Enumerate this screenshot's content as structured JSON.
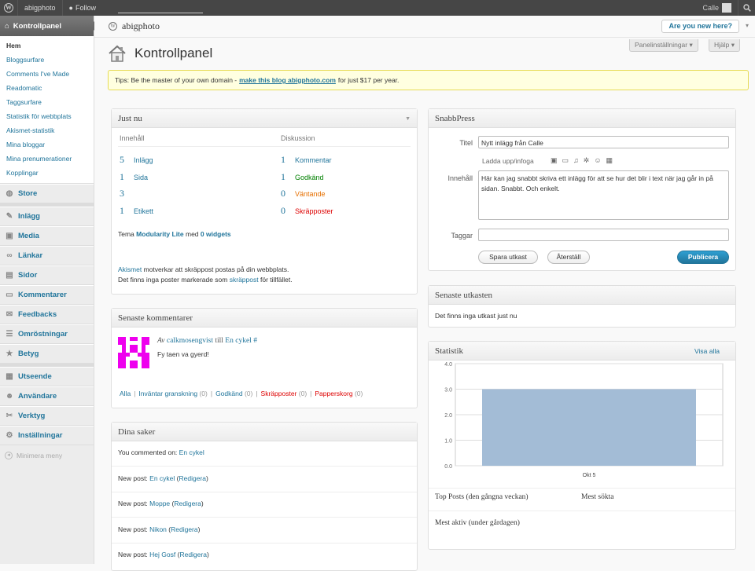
{
  "adminbar": {
    "site_name": "abigphoto",
    "follow_label": "Follow",
    "user_name": "Calle"
  },
  "header": {
    "site_title": "abigphoto",
    "new_here": "Are you new here?",
    "screen_options": "Panelinställningar",
    "help": "Hjälp",
    "page_title": "Kontrollpanel"
  },
  "sidebar": {
    "dashboard_label": "Kontrollpanel",
    "submenu": [
      "Hem",
      "Bloggsurfare",
      "Comments I've Made",
      "Readomatic",
      "Taggsurfare",
      "Statistik för webbplats",
      "Akismet-statistik",
      "Mina bloggar",
      "Mina prenumerationer",
      "Kopplingar"
    ],
    "store": "Store",
    "group1": [
      "Inlägg",
      "Media",
      "Länkar",
      "Sidor",
      "Kommentarer",
      "Feedbacks",
      "Omröstningar",
      "Betyg"
    ],
    "group2": [
      "Utseende",
      "Användare",
      "Verktyg",
      "Inställningar"
    ],
    "collapse": "Minimera meny"
  },
  "tip": {
    "prefix": "Tips: Be the master of your own domain -",
    "link": "make this blog abigphoto.com",
    "suffix": "for just $17 per year."
  },
  "just_nu": {
    "title": "Just nu",
    "col_content": "Innehåll",
    "col_discussion": "Diskussion",
    "content_rows": [
      {
        "num": "5",
        "label": "Inlägg"
      },
      {
        "num": "1",
        "label": "Sida"
      },
      {
        "num": "3",
        "label": ""
      },
      {
        "num": "1",
        "label": "Etikett"
      }
    ],
    "discussion_rows": [
      {
        "num": "1",
        "label": "Kommentar"
      },
      {
        "num": "1",
        "label": "Godkänd"
      },
      {
        "num": "0",
        "label": "Väntande"
      },
      {
        "num": "0",
        "label": "Skräpposter"
      }
    ],
    "theme_prefix": "Tema",
    "theme_name": "Modularity Lite",
    "theme_mid": "med",
    "widgets": "0 widgets",
    "akismet_link": "Akismet",
    "akismet_line1": "motverkar att skräppost postas på din webbplats.",
    "akismet_line2": "Det finns inga poster markerade som",
    "akismet_link2": "skräppost",
    "akismet_line2_end": "för tillfället."
  },
  "recent_comments": {
    "title": "Senaste kommentarer",
    "by": "Av",
    "author": "calkmosengvist",
    "on": "till",
    "post": "En cykel",
    "hash": "#",
    "text": "Fy taen va gyerd!",
    "filters": [
      {
        "label": "Alla",
        "count": ""
      },
      {
        "label": "Inväntar granskning",
        "count": "(0)"
      },
      {
        "label": "Godkänd",
        "count": "(0)"
      },
      {
        "label": "Skräpposter",
        "count": "(0)"
      },
      {
        "label": "Papperskorg",
        "count": "(0)"
      }
    ]
  },
  "dina_saker": {
    "title": "Dina saker",
    "rows": [
      {
        "prefix": "You commented on:",
        "link": "En cykel",
        "edit": ""
      },
      {
        "prefix": "New post:",
        "link": "En cykel",
        "edit": "Redigera"
      },
      {
        "prefix": "New post:",
        "link": "Moppe",
        "edit": "Redigera"
      },
      {
        "prefix": "New post:",
        "link": "Nikon",
        "edit": "Redigera"
      },
      {
        "prefix": "New post:",
        "link": "Hej Gosf",
        "edit": "Redigera"
      }
    ]
  },
  "quickpress": {
    "title": "SnabbPress",
    "title_label": "Titel",
    "title_value": "Nytt inlägg från Calle",
    "upload_label": "Ladda upp/infoga",
    "content_label": "Innehåll",
    "content_value": "Här kan jag snabbt skriva ett inlägg för att se hur det blir i text när jag går in på sidan. Snabbt. Och enkelt.",
    "tags_label": "Taggar",
    "save_draft": "Spara utkast",
    "reset": "Återställ",
    "publish": "Publicera"
  },
  "drafts": {
    "title": "Senaste utkasten",
    "empty": "Det finns inga utkast just nu"
  },
  "stats": {
    "title": "Statistik",
    "view_all": "Visa alla",
    "top_posts": "Top Posts (den gångna veckan)",
    "most_viewed": "Mest sökta",
    "most_active": "Mest aktiv (under gårdagen)"
  },
  "chart_data": {
    "type": "bar",
    "categories": [
      "Okt 5"
    ],
    "values": [
      3.0
    ],
    "ylim": [
      0,
      4
    ],
    "yticks": [
      "0.0",
      "1.0",
      "2.0",
      "3.0",
      "4.0"
    ],
    "bar_color": "#a3bcd6",
    "grid": true
  },
  "colors": {
    "link": "#21759b",
    "adminbar": "#464646"
  }
}
